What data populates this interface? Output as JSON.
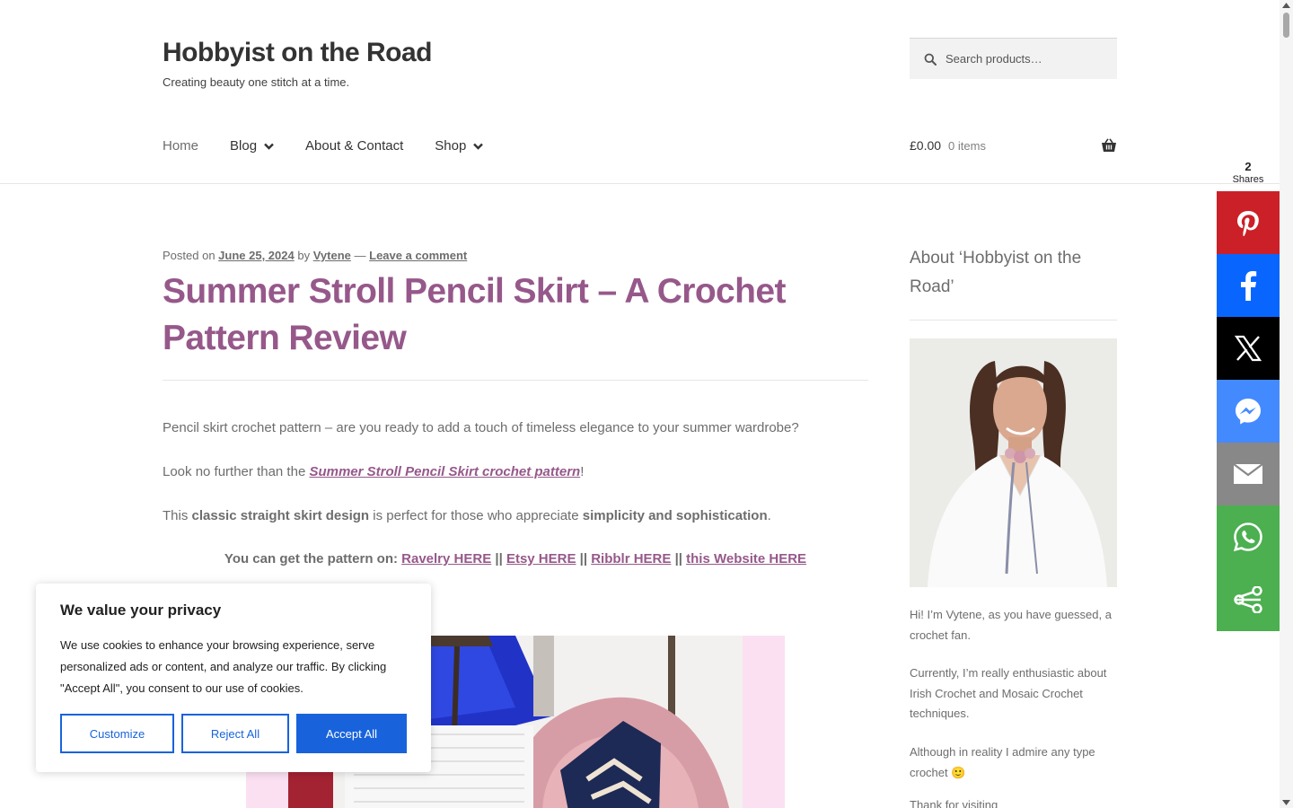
{
  "header": {
    "site_title": "Hobbyist on the Road",
    "tagline": "Creating beauty one stitch at a time.",
    "search_placeholder": "Search products…",
    "nav": [
      {
        "label": "Home",
        "has_dropdown": false
      },
      {
        "label": "Blog",
        "has_dropdown": true
      },
      {
        "label": "About & Contact",
        "has_dropdown": false
      },
      {
        "label": "Shop",
        "has_dropdown": true
      }
    ],
    "cart": {
      "amount": "£0.00",
      "count": "0 items"
    }
  },
  "post": {
    "meta": {
      "posted_on": "Posted on",
      "date": "June 25, 2024",
      "by": "by",
      "author": "Vytene",
      "dash": "—",
      "comment_link": "Leave a comment"
    },
    "title": "Summer Stroll Pencil Skirt – A Crochet Pattern Review",
    "paragraph1": "Pencil skirt crochet pattern – are you ready to add a touch of timeless elegance to your summer wardrobe?",
    "paragraph2": {
      "before": "Look no further than the ",
      "link": "Summer Stroll Pencil Skirt crochet pattern",
      "after": "!"
    },
    "paragraph3": {
      "before": "This ",
      "bold1": "classic straight skirt design",
      "middle": " is perfect for those who appreciate ",
      "bold2": "simplicity and sophistication",
      "after": "."
    },
    "get_pattern": {
      "label": "You can get the pattern on: ",
      "links": [
        "Ravelry HERE",
        "Etsy HERE",
        "Ribblr HERE",
        "this Website HERE"
      ],
      "separator": " || "
    }
  },
  "sidebar": {
    "about_title": "About ‘Hobbyist on the Road’",
    "p1": "Hi! I’m Vytene, as you have guessed, a crochet fan.",
    "p2": "Currently, I’m really enthusiastic about Irish Crochet and Mosaic Crochet techniques.",
    "p3": "Although in reality I admire any type crochet 🙂",
    "p4": "Thank for visiting"
  },
  "share_bar": {
    "count": "2",
    "count_label": "Shares",
    "buttons": [
      {
        "name": "pinterest",
        "icon": "pinterest-icon",
        "color": "#cb2027"
      },
      {
        "name": "facebook",
        "icon": "facebook-icon",
        "color": "#0866ff"
      },
      {
        "name": "x",
        "icon": "x-icon",
        "color": "#000000"
      },
      {
        "name": "messenger",
        "icon": "messenger-icon",
        "color": "#448aff"
      },
      {
        "name": "email",
        "icon": "email-icon",
        "color": "#888888"
      },
      {
        "name": "whatsapp",
        "icon": "whatsapp-icon",
        "color": "#4caf50"
      },
      {
        "name": "more",
        "icon": "share-icon",
        "color": "#4caf50"
      }
    ]
  },
  "cookie_banner": {
    "title": "We value your privacy",
    "text": "We use cookies to enhance your browsing experience, serve personalized ads or content, and analyze our traffic. By clicking \"Accept All\", you consent to our use of cookies.",
    "customize": "Customize",
    "reject": "Reject All",
    "accept": "Accept All",
    "accent": "#1863dc"
  },
  "colors": {
    "link_purple": "#96588a",
    "text": "#6d6d6d",
    "title": "#333333"
  }
}
